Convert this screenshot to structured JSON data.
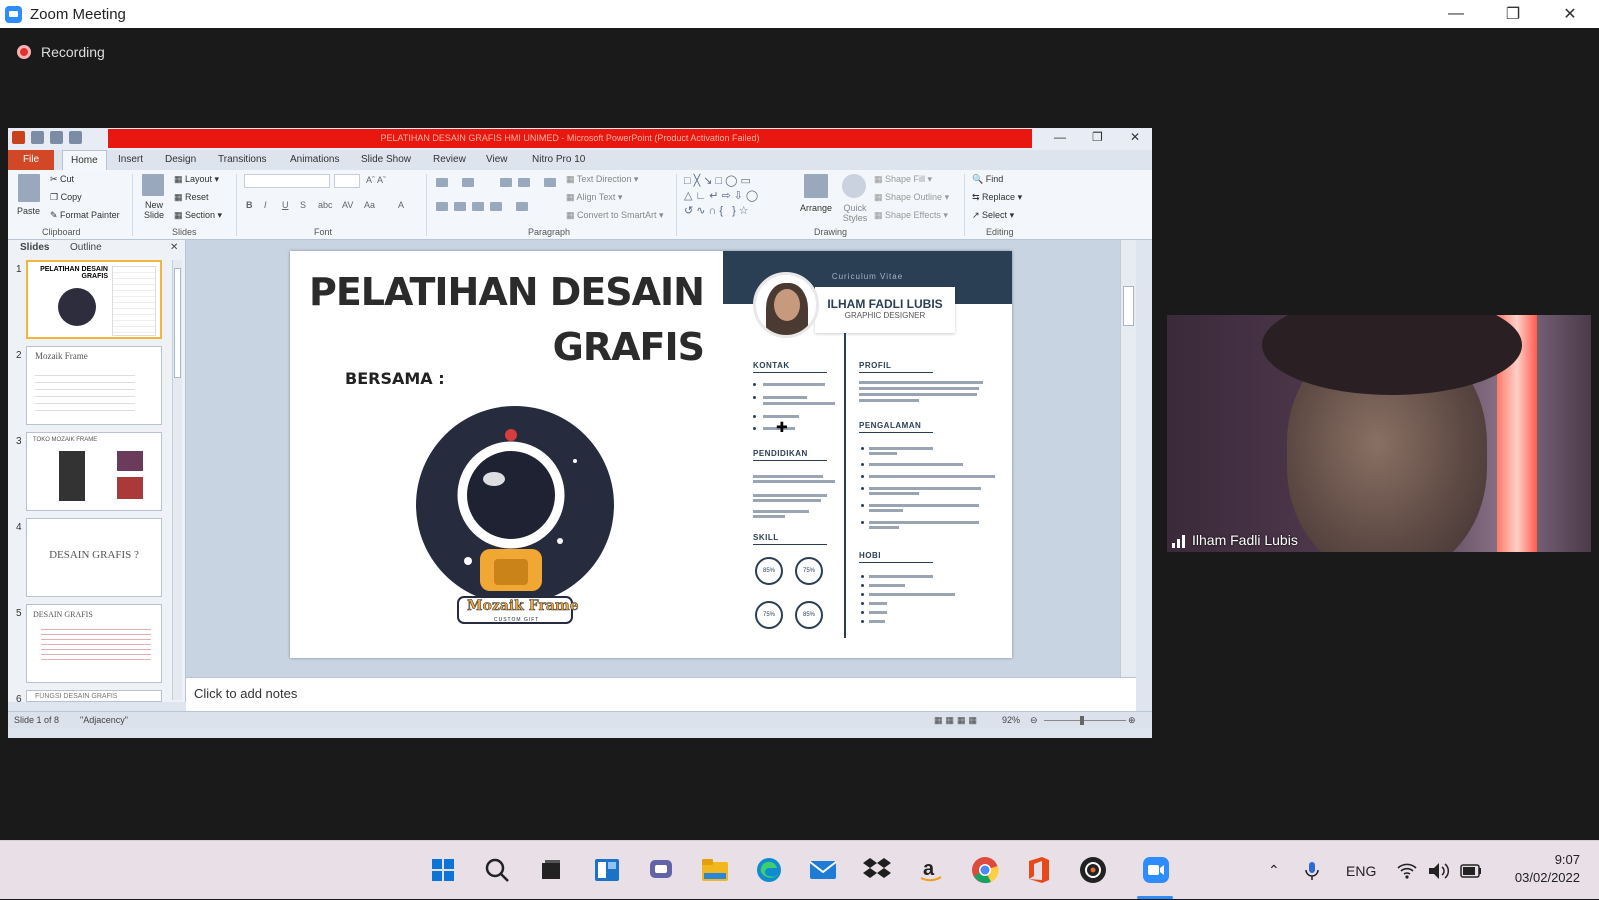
{
  "zoom": {
    "window_title": "Zoom Meeting",
    "recording_label": "Recording",
    "participant_name": "Ilham Fadli Lubis"
  },
  "ppt": {
    "title_bar": "PELATIHAN DESAIN GRAFIS HMI UNIMED - Microsoft PowerPoint (Product Activation Failed)",
    "tabs": [
      "File",
      "Home",
      "Insert",
      "Design",
      "Transitions",
      "Animations",
      "Slide Show",
      "Review",
      "View",
      "Nitro Pro 10"
    ],
    "clipboard": {
      "paste": "Paste",
      "cut": "Cut",
      "copy": "Copy",
      "format_painter": "Format Painter",
      "group": "Clipboard"
    },
    "slides_group": {
      "new_slide": "New Slide",
      "layout": "Layout",
      "reset": "Reset",
      "section": "Section",
      "group": "Slides"
    },
    "font_group": "Font",
    "paragraph": {
      "text_direction": "Text Direction",
      "align_text": "Align Text",
      "convert": "Convert to SmartArt",
      "group": "Paragraph"
    },
    "drawing": {
      "arrange": "Arrange",
      "quick_styles": "Quick Styles",
      "shape_fill": "Shape Fill",
      "shape_outline": "Shape Outline",
      "shape_effects": "Shape Effects",
      "group": "Drawing"
    },
    "editing": {
      "find": "Find",
      "replace": "Replace",
      "select": "Select",
      "group": "Editing"
    },
    "pane_tabs": {
      "slides": "Slides",
      "outline": "Outline"
    },
    "thumbs": [
      {
        "num": "1",
        "title": "PELATIHAN DESAIN GRAFIS"
      },
      {
        "num": "2",
        "title": "Mozaik Frame"
      },
      {
        "num": "3",
        "title": "TOKO MOZAIK FRAME"
      },
      {
        "num": "4",
        "title": "DESAIN GRAFIS ?"
      },
      {
        "num": "5",
        "title": "DESAIN GRAFIS"
      },
      {
        "num": "6",
        "title": "FUNGSI DESAIN GRAFIS"
      }
    ],
    "slide": {
      "title_line1": "PELATIHAN DESAIN",
      "title_line2": "GRAFIS",
      "bersama": "BERSAMA :",
      "logo_text": "Mozaik Frame",
      "logo_sub": "CUSTOM GIFT",
      "cv": {
        "header": "Curiculum Vitae",
        "name": "ILHAM FADLI LUBIS",
        "role": "GRAPHIC DESIGNER",
        "kontak": "KONTAK",
        "pendidikan": "PENDIDIKAN",
        "skill": "SKILL",
        "profil": "PROFIL",
        "pengalaman": "PENGALAMAN",
        "hobi": "HOBI",
        "skills": [
          "85%",
          "75%",
          "75%",
          "85%"
        ]
      }
    },
    "notes_placeholder": "Click to add notes",
    "status": {
      "slide_of": "Slide 1 of 8",
      "theme": "\"Adjacency\"",
      "zoom": "92%"
    }
  },
  "taskbar": {
    "lang": "ENG",
    "time": "9:07",
    "date": "03/02/2022"
  },
  "colors": {
    "zoom_blue": "#2d8cff",
    "ppt_red": "#e8170f",
    "cv_navy": "#2b3f54"
  }
}
